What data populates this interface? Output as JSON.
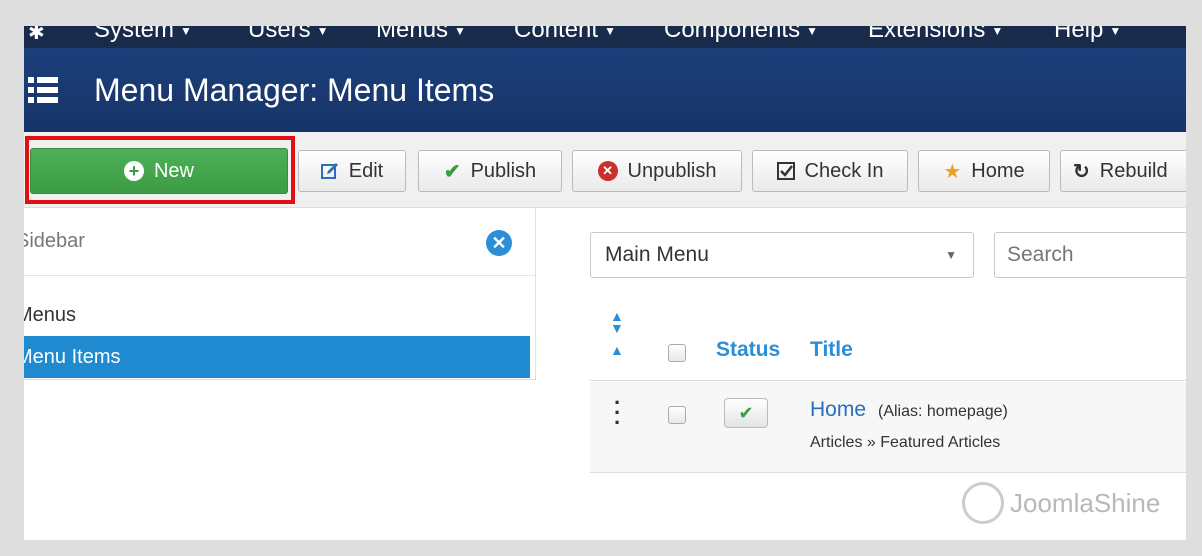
{
  "topnav": {
    "items": [
      {
        "label": "System"
      },
      {
        "label": "Users"
      },
      {
        "label": "Menus"
      },
      {
        "label": "Content"
      },
      {
        "label": "Components"
      },
      {
        "label": "Extensions"
      },
      {
        "label": "Help"
      }
    ]
  },
  "header": {
    "title": "Menu Manager: Menu Items"
  },
  "toolbar": {
    "new_label": "New",
    "edit_label": "Edit",
    "publish_label": "Publish",
    "unpublish_label": "Unpublish",
    "checkin_label": "Check In",
    "home_label": "Home",
    "rebuild_label": "Rebuild"
  },
  "sidebar": {
    "title": "Sidebar",
    "items": [
      {
        "label": "Menus"
      },
      {
        "label": "Menu Items"
      }
    ]
  },
  "filters": {
    "menu_select": "Main Menu",
    "search_placeholder": "Search"
  },
  "table": {
    "headers": {
      "status": "Status",
      "title": "Title"
    },
    "rows": [
      {
        "title": "Home",
        "alias": "(Alias: homepage)",
        "type": "Articles » Featured Articles"
      }
    ]
  },
  "watermark": {
    "text": "JoomlaShine"
  },
  "colors": {
    "nav": "#182b4a",
    "header": "#1c3f7a",
    "new_button": "#46a74e",
    "accent": "#2a8fd6",
    "highlight": "#e01010"
  }
}
